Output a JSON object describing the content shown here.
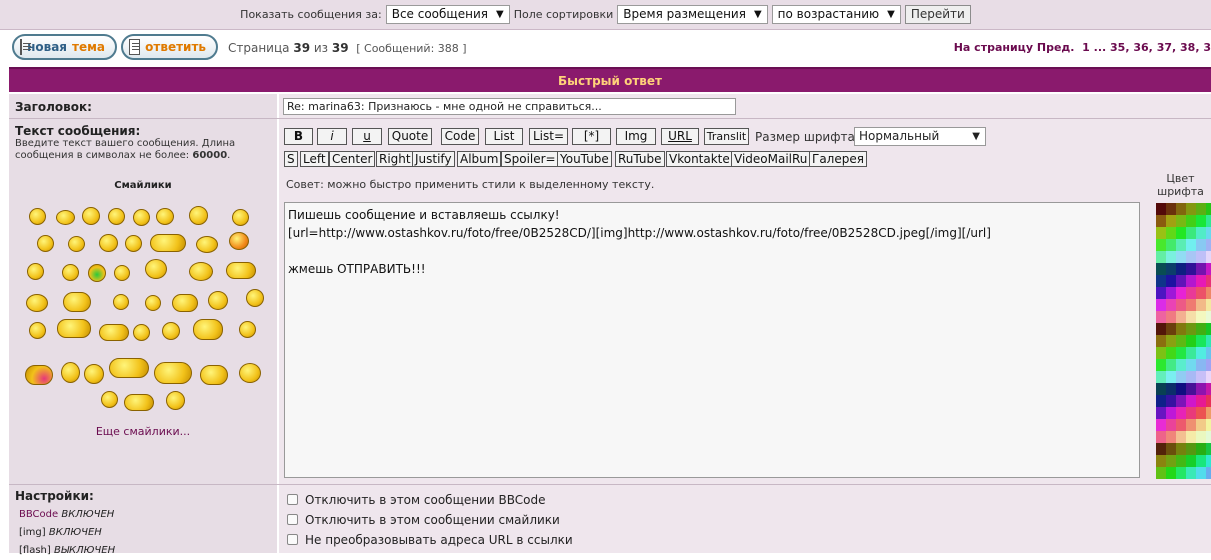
{
  "sortbar": {
    "show_label": "Показать сообщения за:",
    "show_value": "Все сообщения",
    "sort_label": "Поле сортировки",
    "sort_value": "Время размещения",
    "order_value": "по возрастанию",
    "go_label": "Перейти"
  },
  "actions": {
    "new_topic_a": "новая",
    "new_topic_b": "тема",
    "reply": "ответить"
  },
  "pageinfo": {
    "page_word": "Страница",
    "page_current": "39",
    "of_word": "из",
    "page_total": "39",
    "messages": "[ Сообщений: 388 ]"
  },
  "pager": {
    "label": "На страницу",
    "prev": "Пред.",
    "first": "1",
    "dots": "...",
    "pages": [
      "35",
      "36",
      "37",
      "38",
      "3"
    ]
  },
  "quick_reply": {
    "title": "Быстрый ответ"
  },
  "subject": {
    "label": "Заголовок:",
    "value": "Re: marina63: Признаюсь - мне одной не справиться..."
  },
  "message": {
    "label": "Текст сообщения:",
    "hint_line1": "Введите текст вашего сообщения. Длина",
    "hint_line2_prefix": "сообщения в символах не более:",
    "hint_limit": "60000",
    "hint_dot": ".",
    "smileys_label": "Смайлики",
    "more_smileys": "Еще смайлики...",
    "tip": "Совет: можно быстро применить стили к выделенному тексту.",
    "text": "Пишешь сообщение и вставляешь ссылку!\n[url=http://www.ostashkov.ru/foto/free/0B2528CD/][img]http://www.ostashkov.ru/foto/free/0B2528CD.jpeg[/img][/url]\n\nжмешь ОТПРАВИТЬ!!!"
  },
  "toolbar": {
    "row1": [
      "B",
      "i",
      "u",
      "Quote",
      "Code",
      "List",
      "List=",
      "[*]",
      "Img",
      "URL",
      "Translit"
    ],
    "font_size_label": "Размер шрифта:",
    "font_size_value": "Нормальный",
    "row2": [
      "S",
      "Left",
      "Center",
      "Right",
      "Justify",
      "Album",
      "Spoiler=",
      "YouTube",
      "RuTube",
      "Vkontakte",
      "VideoMailRu",
      "Галерея"
    ]
  },
  "color": {
    "label_line1": "Цвет",
    "label_line2": "шрифта"
  },
  "settings": {
    "label": "Настройки:",
    "bbcode_name": "BBCode",
    "bbcode_state": "ВКЛЮЧЕН",
    "img_name": "[img]",
    "img_state": "ВКЛЮЧЕН",
    "flash_name": "[flash]",
    "flash_state": "ВЫКЛЮЧЕН",
    "options": [
      "Отключить в этом сообщении BBCode",
      "Отключить в этом сообщении смайлики",
      "Не преобразовывать адреса URL в ссылки"
    ]
  },
  "colors": {
    "header_bg": "#8a1a6d",
    "header_text": "#ffd27a",
    "link": "#6b0b4f",
    "panel": "#e7dde5"
  }
}
